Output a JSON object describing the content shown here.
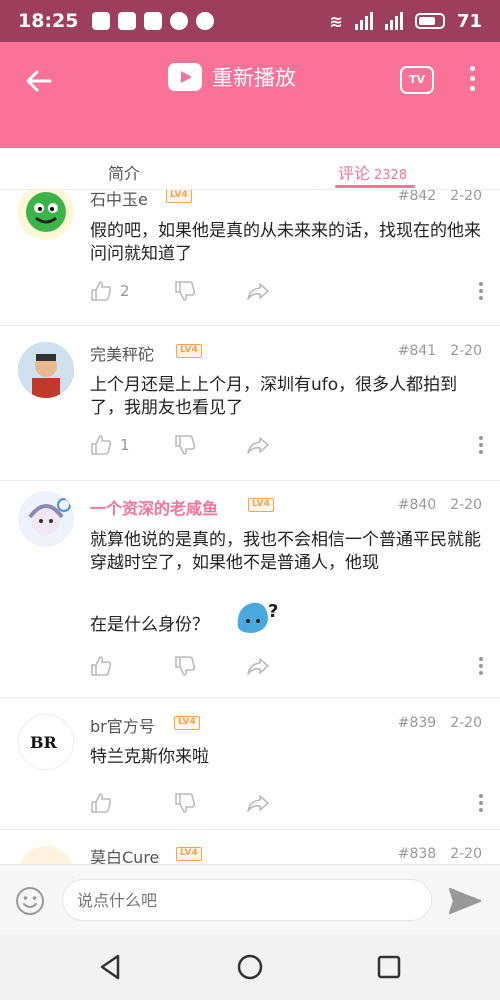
{
  "status_bar": {
    "time": "18:25",
    "battery": "71",
    "net1": "4G",
    "net2": "4G"
  },
  "app_bar": {
    "title": "重新播放",
    "tv_label": "TV"
  },
  "tabs": {
    "intro": "简介",
    "comments": "评论",
    "comment_count": "2328"
  },
  "comments": [
    {
      "user": "石中玉e",
      "level": "LV4",
      "floor": "#842",
      "date": "2-20",
      "text": "假的吧，如果他是真的从未来来的话，找现在的他来问问就知道了",
      "likes": "2"
    },
    {
      "user": "完美秤砣",
      "level": "LV4",
      "floor": "#841",
      "date": "2-20",
      "text": "上个月还是上上个月，深圳有ufo，很多人都拍到了，我朋友也看见了",
      "likes": "1"
    },
    {
      "user": "一个资深的老咸鱼",
      "level": "LV4",
      "floor": "#840",
      "date": "2-20",
      "text": "就算他说的是真的，我也不会相信一个普通平民就能穿越时空了，如果他不是普通人，他现",
      "text2": "在是什么身份？",
      "likes": ""
    },
    {
      "user": "br官方号",
      "level": "LV4",
      "floor": "#839",
      "date": "2-20",
      "text": "特兰克斯你来啦",
      "likes": "",
      "avatar_text": "BR"
    },
    {
      "user": "莫白Cure",
      "level": "LV4",
      "floor": "#838",
      "date": "2-20"
    }
  ],
  "composer": {
    "placeholder": "说点什么吧"
  },
  "colors": {
    "accent": "#fb7299",
    "status_bar": "#9c3e5c",
    "level_badge": "#f9a24b"
  }
}
